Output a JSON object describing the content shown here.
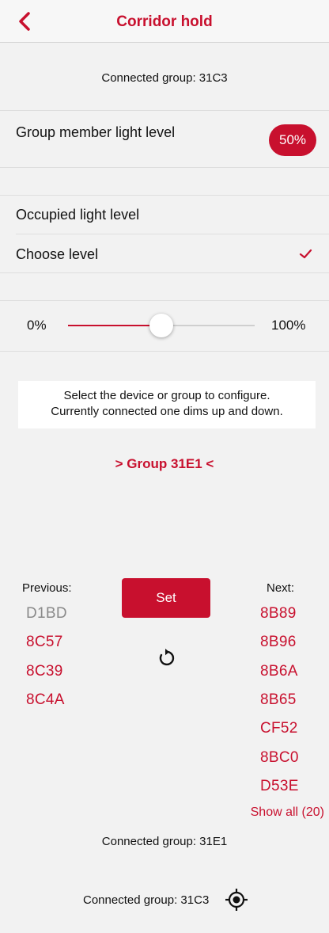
{
  "header": {
    "title": "Corridor hold",
    "back_icon": "chevron-left-icon"
  },
  "connected_top": "Connected group: 31C3",
  "group_member": {
    "label": "Group member light level",
    "value": "50%"
  },
  "occupied": {
    "label": "Occupied light level",
    "choose_label": "Choose level",
    "check_icon": "checkmark-icon"
  },
  "slider": {
    "min_label": "0%",
    "max_label": "100%",
    "value_fraction": 0.5
  },
  "info": {
    "line1": "Select the device or group to configure.",
    "line2": "Currently connected one dims up and down."
  },
  "current_group": "> Group 31E1 <",
  "previous": {
    "heading": "Previous:",
    "items": [
      "D1BD",
      "8C57",
      "8C39",
      "8C4A"
    ]
  },
  "next": {
    "heading": "Next:",
    "items": [
      "8B89",
      "8B96",
      "8B6A",
      "8B65",
      "CF52",
      "8BC0",
      "D53E"
    ]
  },
  "set_label": "Set",
  "refresh_icon": "refresh-icon",
  "show_all": "Show all (20)",
  "connected_middle": "Connected group: 31E1",
  "connected_bottom": "Connected group: 31C3",
  "locate_icon": "locate-icon",
  "colors": {
    "accent": "#c8102e",
    "background": "#f2f2f2",
    "muted": "#8a8a8a"
  }
}
